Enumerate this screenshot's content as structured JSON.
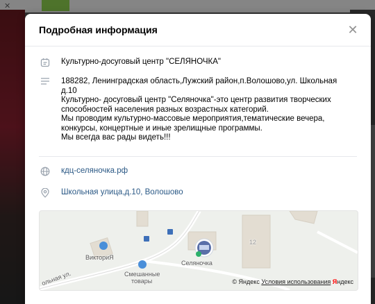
{
  "modal": {
    "title": "Подробная информация",
    "org_name": "Культурно-досуговый центр \"СЕЛЯНОЧКА\"",
    "description_lines": [
      "188282, Ленинградская область,Лужский район,п.Волошово,ул. Школьная",
      "д.10",
      "Культурно- досуговый центр \"Селяночка\"-это центр развития творческих",
      "способностей населения разных возрастных категорий.",
      "Мы проводим культурно-массовые мероприятия,тематические вечера,",
      "конкурсы, концертные и иные зрелищные программы.",
      "Мы всегда вас рады видеть!!!"
    ],
    "website": "кдц-селяночка.рф",
    "address": "Школьная улица,д.10, Волошово"
  },
  "map": {
    "labels": {
      "victoria": "ВикториЯ",
      "selyanochka": "Селяночка",
      "shop_line1": "Смешанные",
      "shop_line2": "товары",
      "street": "ольная ул.",
      "house_number": "12"
    },
    "copyright_prefix": "© Яндекс",
    "terms_link": "Условия использования",
    "brand_ya": "Я",
    "brand_rest": "ндекс"
  },
  "colors": {
    "link": "#2a5885",
    "icon": "#99a2ad",
    "brand": "#ff0000"
  }
}
